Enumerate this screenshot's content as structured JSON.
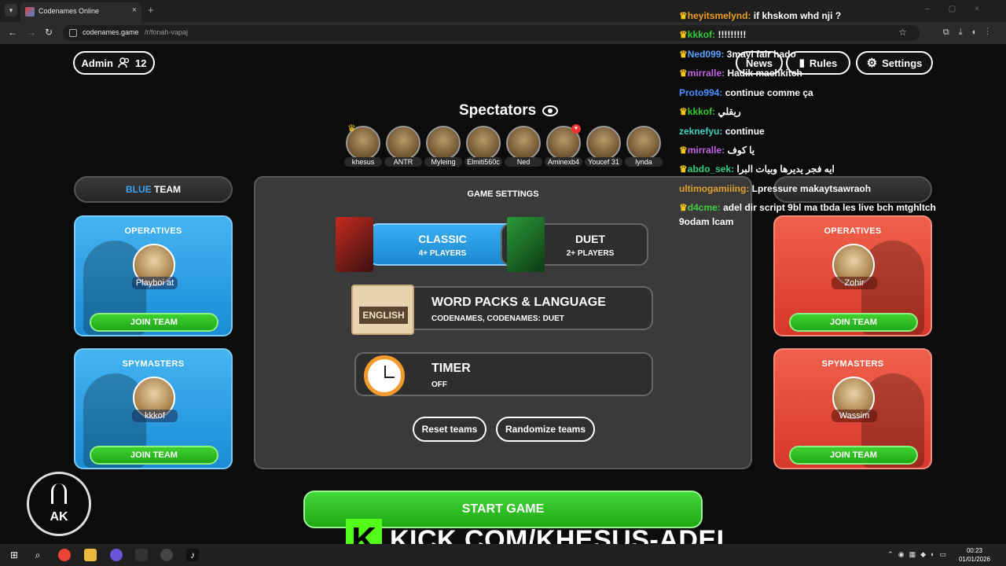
{
  "browser": {
    "tab_title": "Codenames Online",
    "new_tab": "+",
    "domain": "codenames.game",
    "path": "/r/fonah-vapaj"
  },
  "header": {
    "admin_label": "Admin",
    "player_count": "12",
    "news_label": "News",
    "rules_label": "Rules",
    "settings_label": "Settings"
  },
  "spectators": {
    "title": "Spectators",
    "list": [
      "khesus",
      "ANTR",
      "Myleing",
      "Elmiti560c",
      "Ned",
      "Aminexb4",
      "Youcef 31",
      "lynda"
    ]
  },
  "blue_team": {
    "title_prefix": "BLUE",
    "title_suffix": " TEAM",
    "operatives_title": "OPERATIVES",
    "operative_player": "Playboi at",
    "spymasters_title": "SPYMASTERS",
    "spymaster_player": "kkkof",
    "join_label": "JOIN TEAM"
  },
  "red_team": {
    "operatives_title": "OPERATIVES",
    "operative_player": "Zohir",
    "spymasters_title": "SPYMASTERS",
    "spymaster_player": "Wassim",
    "join_label": "JOIN TEAM"
  },
  "settings": {
    "title": "GAME SETTINGS",
    "classic_name": "CLASSIC",
    "classic_sub": "4+ PLAYERS",
    "duet_name": "DUET",
    "duet_sub": "2+ PLAYERS",
    "packs_title": "WORD PACKS & LANGUAGE",
    "packs_sub": "CODENAMES, CODENAMES: DUET",
    "language_badge": "ENGLISH",
    "timer_title": "TIMER",
    "timer_sub": "OFF",
    "reset_label": "Reset teams",
    "randomize_label": "Randomize teams"
  },
  "start_label": "START GAME",
  "chat": [
    {
      "user": "heyitsmelynd:",
      "msg": " if khskom whd nji ?",
      "color": "#f0a020"
    },
    {
      "user": "kkkof:",
      "msg": " !!!!!!!!!",
      "color": "#33cc33"
    },
    {
      "user": "Ned099:",
      "msg": " 3mayi fair hado",
      "color": "#5aa0ff"
    },
    {
      "user": "mirralle:",
      "msg": " Hadik machkitch",
      "color": "#c060e0"
    },
    {
      "user": "Proto994:",
      "msg": " continue comme ça",
      "color": "#4a90ff"
    },
    {
      "user": "kkkof:",
      "msg": " ريقلي",
      "color": "#33cc33"
    },
    {
      "user": "zeknefyu:",
      "msg": " continue",
      "color": "#40d0c0"
    },
    {
      "user": "mirralle:",
      "msg": " يا كوف",
      "color": "#c060e0"
    },
    {
      "user": "abdo_sek:",
      "msg": " ايه فجر يديرها وبيات البرا",
      "color": "#33cc88"
    },
    {
      "user": "ultimogamiiing:",
      "msg": " Lpressure makaytsawraoh",
      "color": "#e0a030"
    },
    {
      "user": "d4cme:",
      "msg": " adel dir script 9bl ma tbda les live bch mtghltch",
      "color": "#44cc44"
    },
    {
      "user": "",
      "msg": "9odam lcam",
      "color": "#ffffff"
    }
  ],
  "overlay": {
    "kick_letter": "K",
    "kick_url": "KICK.COM/KHESUS-ADEL",
    "logo_text": "AK"
  },
  "taskbar": {
    "time": "00:23",
    "date": "01/01/2026"
  }
}
